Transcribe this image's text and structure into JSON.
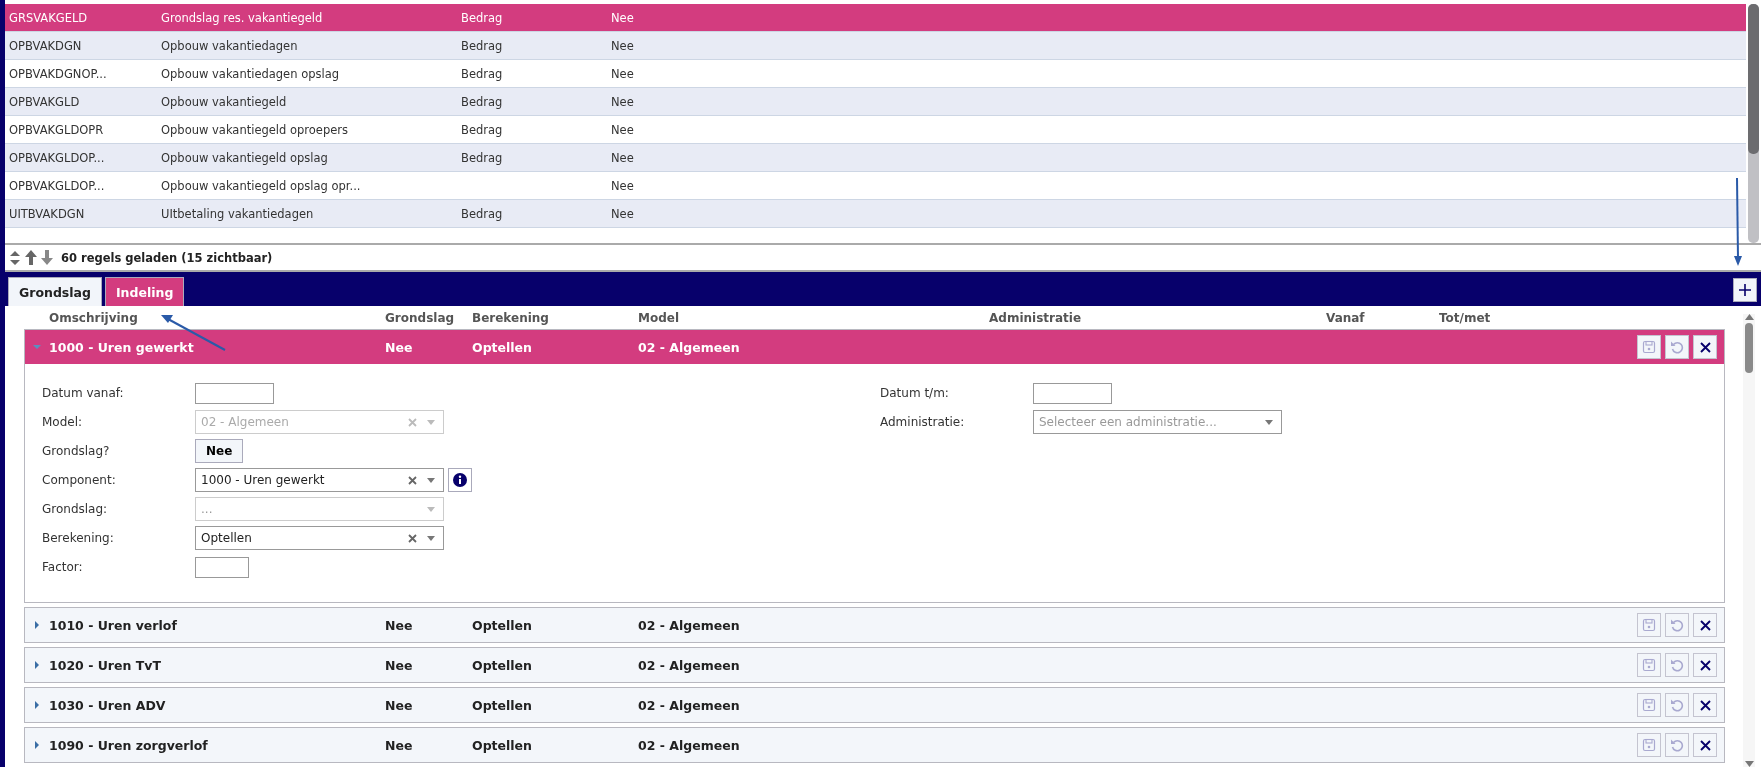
{
  "grid": {
    "rows": [
      {
        "code": "GRSVAKGELD",
        "description": "Grondslag res. vakantiegeld",
        "type": "Bedrag",
        "flag": "Nee",
        "selected": true
      },
      {
        "code": "OPBVAKDGN",
        "description": "Opbouw vakantiedagen",
        "type": "Bedrag",
        "flag": "Nee",
        "selected": false
      },
      {
        "code": "OPBVAKDGNOP...",
        "description": "Opbouw vakantiedagen opslag",
        "type": "Bedrag",
        "flag": "Nee",
        "selected": false
      },
      {
        "code": "OPBVAKGLD",
        "description": "Opbouw vakantiegeld",
        "type": "Bedrag",
        "flag": "Nee",
        "selected": false
      },
      {
        "code": "OPBVAKGLDOPR",
        "description": "Opbouw vakantiegeld oproepers",
        "type": "Bedrag",
        "flag": "Nee",
        "selected": false
      },
      {
        "code": "OPBVAKGLDOP...",
        "description": "Opbouw vakantiegeld opslag",
        "type": "Bedrag",
        "flag": "Nee",
        "selected": false
      },
      {
        "code": "OPBVAKGLDOP...",
        "description": "Opbouw vakantiegeld opslag opr...",
        "type": "",
        "flag": "Nee",
        "selected": false
      },
      {
        "code": "UITBVAKDGN",
        "description": "UItbetaling vakantiedagen",
        "type": "Bedrag",
        "flag": "Nee",
        "selected": false
      }
    ],
    "status": "60 regels geladen (15 zichtbaar)"
  },
  "tabs": [
    {
      "label": "Grondslag",
      "selected": false
    },
    {
      "label": "Indeling",
      "selected": true
    }
  ],
  "columns": [
    "Omschrijving",
    "Grondslag",
    "Berekening",
    "Model",
    "Administratie",
    "Vanaf",
    "Tot/met"
  ],
  "items": [
    {
      "title": "1000 - Uren gewerkt",
      "grondslag": "Nee",
      "berekening": "Optellen",
      "model": "02 - Algemeen",
      "expanded": true
    },
    {
      "title": "1010 - Uren verlof",
      "grondslag": "Nee",
      "berekening": "Optellen",
      "model": "02 - Algemeen",
      "expanded": false
    },
    {
      "title": "1020 - Uren TvT",
      "grondslag": "Nee",
      "berekening": "Optellen",
      "model": "02 - Algemeen",
      "expanded": false
    },
    {
      "title": "1030 - Uren ADV",
      "grondslag": "Nee",
      "berekening": "Optellen",
      "model": "02 - Algemeen",
      "expanded": false
    },
    {
      "title": "1090 - Uren zorgverlof",
      "grondslag": "Nee",
      "berekening": "Optellen",
      "model": "02 - Algemeen",
      "expanded": false
    }
  ],
  "form": {
    "left": [
      {
        "label": "Datum vanaf:",
        "kind": "date"
      },
      {
        "label": "Model:",
        "kind": "select",
        "value": "02 - Algemeen",
        "disabled": true,
        "clearable": true
      },
      {
        "label": "Grondslag?",
        "kind": "toggle",
        "value": "Nee"
      },
      {
        "label": "Component:",
        "kind": "select",
        "value": "1000 - Uren gewerkt",
        "disabled": false,
        "clearable": true,
        "info": true
      },
      {
        "label": "Grondslag:",
        "kind": "select",
        "placeholder": "...",
        "disabled": true,
        "clearable": false
      },
      {
        "label": "Berekening:",
        "kind": "select",
        "value": "Optellen",
        "disabled": false,
        "clearable": true
      },
      {
        "label": "Factor:",
        "kind": "number"
      }
    ],
    "right": [
      {
        "label": "Datum t/m:",
        "kind": "date"
      },
      {
        "label": "Administratie:",
        "kind": "select",
        "placeholder": "Selecteer een administratie...",
        "disabled": false,
        "clearable": false
      }
    ]
  }
}
